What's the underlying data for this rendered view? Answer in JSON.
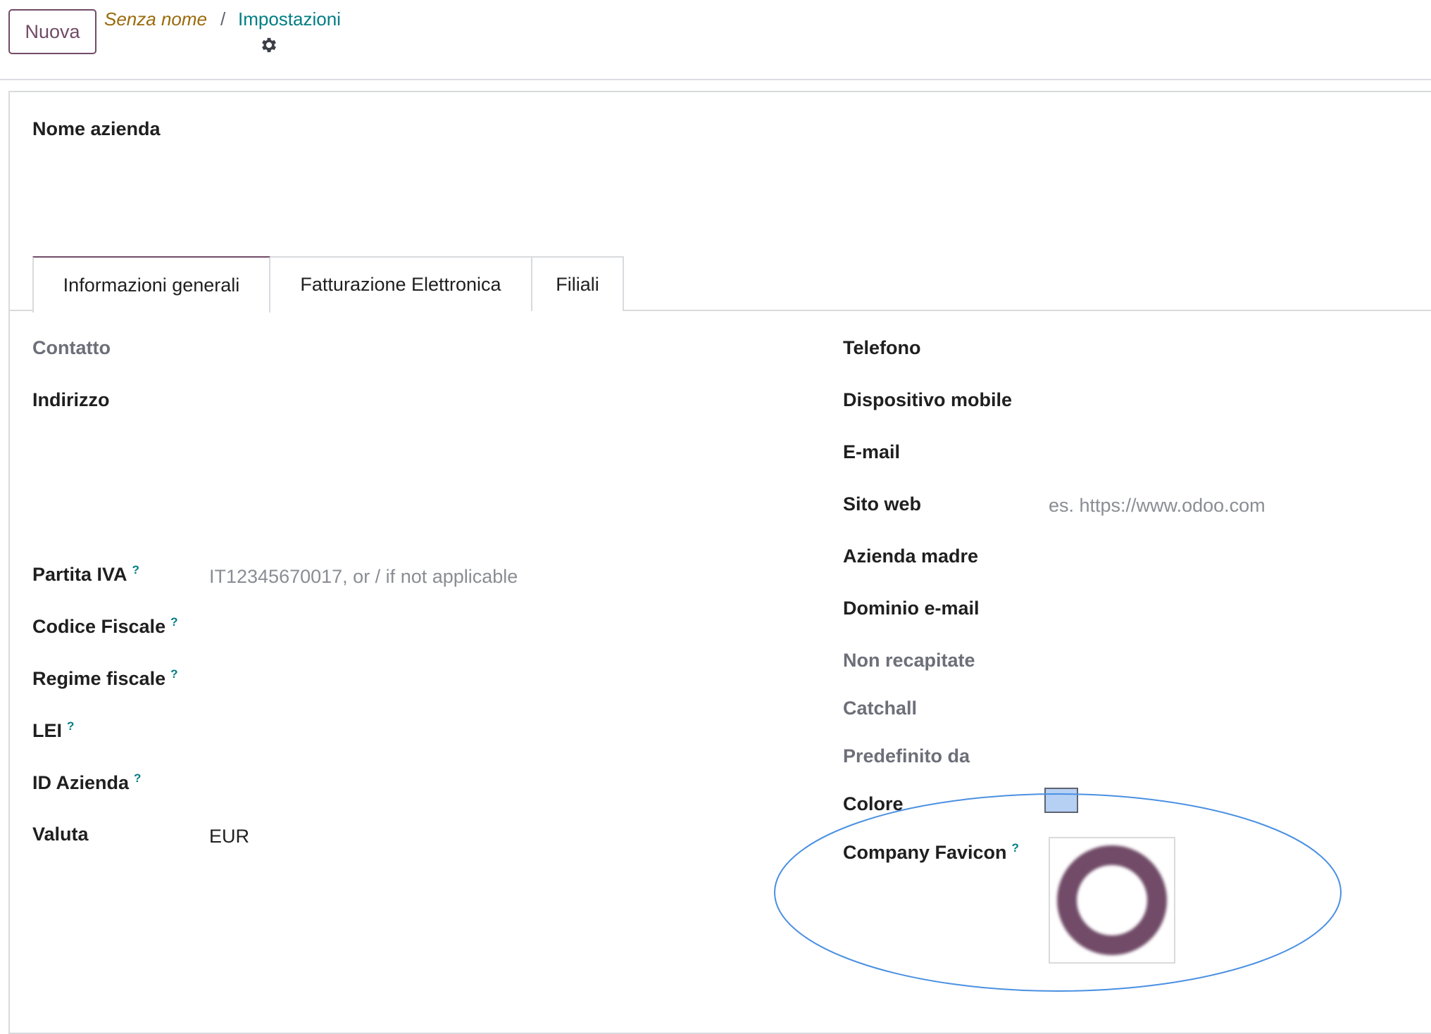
{
  "control_panel": {
    "new_button": "Nuova",
    "breadcrumb_root": "Senza nome",
    "breadcrumb_separator": "/",
    "breadcrumb_current": "Impostazioni",
    "gear_icon": "gear-icon"
  },
  "form": {
    "company_name_label": "Nome azienda",
    "tabs": [
      {
        "label": "Informazioni generali",
        "active": true
      },
      {
        "label": "Fatturazione Elettronica",
        "active": false
      },
      {
        "label": "Filiali",
        "active": false
      }
    ],
    "left": {
      "contact": "Contatto",
      "address": "Indirizzo",
      "vat": {
        "label": "Partita IVA",
        "help": "?",
        "placeholder": "IT12345670017, or / if not applicable"
      },
      "fiscal_code": {
        "label": "Codice Fiscale",
        "help": "?"
      },
      "tax_regime": {
        "label": "Regime fiscale",
        "help": "?"
      },
      "lei": {
        "label": "LEI",
        "help": "?"
      },
      "company_id": {
        "label": "ID Azienda",
        "help": "?"
      },
      "currency": {
        "label": "Valuta",
        "value": "EUR"
      }
    },
    "right": {
      "phone": "Telefono",
      "mobile": "Dispositivo mobile",
      "email": "E-mail",
      "website": {
        "label": "Sito web",
        "placeholder": "es. https://www.odoo.com"
      },
      "parent_company": "Azienda madre",
      "email_domain": "Dominio e-mail",
      "bounce": "Non recapitate",
      "catchall": "Catchall",
      "default_from": "Predefinito da",
      "color": {
        "label": "Colore",
        "value": "#b6d0f4"
      },
      "favicon": {
        "label": "Company Favicon",
        "help": "?"
      }
    }
  },
  "colors": {
    "brand": "#714b67",
    "link": "#017e84",
    "annotation": "#4a90e2"
  }
}
